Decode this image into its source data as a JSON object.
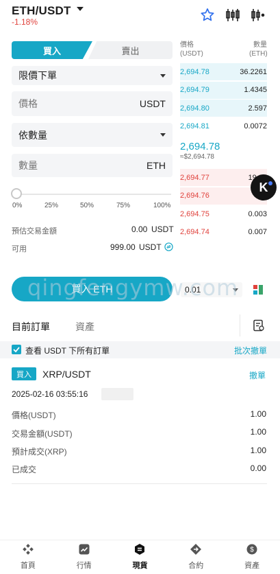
{
  "header": {
    "pair": "ETH/USDT",
    "change": "-1.18%"
  },
  "trade_tabs": {
    "buy": "買入",
    "sell": "賣出"
  },
  "order_type": {
    "value": "限價下單"
  },
  "price_field": {
    "placeholder": "價格",
    "unit": "USDT"
  },
  "amount_mode": {
    "value": "依數量"
  },
  "qty_field": {
    "placeholder": "數量",
    "unit": "ETH"
  },
  "slider": {
    "value_pct": 0,
    "marks": [
      "0%",
      "25%",
      "50%",
      "75%",
      "100%"
    ]
  },
  "estimate": {
    "label": "預估交易金額",
    "value": "0.00",
    "unit": "USDT"
  },
  "available": {
    "label": "可用",
    "value": "999.00",
    "unit": "USDT"
  },
  "submit": {
    "label": "買入 ETH"
  },
  "orderbook": {
    "price_header": "價格\n(USDT)",
    "qty_header": "數量\n(ETH)",
    "bids": [
      {
        "price": "2,694.78",
        "qty": "36.2261",
        "depth": 1.0
      },
      {
        "price": "2,694.79",
        "qty": "1.4345",
        "depth": 1.0
      },
      {
        "price": "2,694.80",
        "qty": "2.597",
        "depth": 1.0
      },
      {
        "price": "2,694.81",
        "qty": "0.0072",
        "depth": 0.0
      }
    ],
    "mid_price": "2,694.78",
    "mid_approx": "≈$2,694.78",
    "asks": [
      {
        "price": "2,694.77",
        "qty": "19.99",
        "depth": 1.0
      },
      {
        "price": "2,694.76",
        "qty": "0.4",
        "depth": 1.0
      },
      {
        "price": "2,694.75",
        "qty": "0.003",
        "depth": 0.0
      },
      {
        "price": "2,694.74",
        "qty": "0.007",
        "depth": 0.0
      }
    ],
    "depth_select": "0.01"
  },
  "orders": {
    "tab_open": "目前訂單",
    "tab_assets": "資產",
    "filter_label": "查看 USDT 下所有訂單",
    "batch_cancel": "批次撤單",
    "item": {
      "side": "買入",
      "pair": "XRP/USDT",
      "cancel": "撤單",
      "datetime": "2025-02-16 03:55:16",
      "rows": [
        {
          "label": "價格(USDT)",
          "value": "1.00"
        },
        {
          "label": "交易金額(USDT)",
          "value": "1.00"
        },
        {
          "label": "預計成交(XRP)",
          "value": "1.00"
        },
        {
          "label": "已成交",
          "value": "0.00"
        }
      ]
    }
  },
  "nav": [
    {
      "label": "首頁",
      "icon": "home-icon"
    },
    {
      "label": "行情",
      "icon": "market-icon"
    },
    {
      "label": "現貨",
      "icon": "spot-icon",
      "active": true
    },
    {
      "label": "合約",
      "icon": "futures-icon"
    },
    {
      "label": "資產",
      "icon": "wallet-icon"
    }
  ],
  "watermark": "qingfengymw.com",
  "colors": {
    "accent": "#17a7c6",
    "down": "#e0423c"
  }
}
